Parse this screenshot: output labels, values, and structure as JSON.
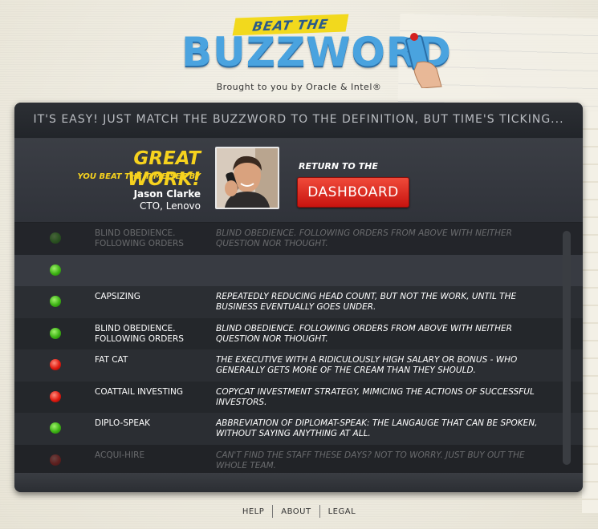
{
  "header": {
    "banner": "BEAT THE",
    "logo": "BUZZWORD",
    "sponsor": "Brought to you by Oracle & Intel®"
  },
  "instruction": "IT'S EASY! JUST MATCH THE BUZZWORD TO THE DEFINITION, BUT TIME'S TICKING...",
  "result": {
    "headline": "GREAT WORK!",
    "beat_text": "YOU BEAT THE TIME SET BY",
    "person_name": "Jason Clarke",
    "person_title": "CTO, Lenovo",
    "return_label": "RETURN TO THE",
    "dashboard_label": "DASHBOARD"
  },
  "rows": [
    {
      "status": "green",
      "faded": true,
      "term": "BLIND OBEDIENCE. FOLLOWING ORDERS",
      "definition": "BLIND OBEDIENCE.  FOLLOWING ORDERS FROM ABOVE WITH NEITHER QUESTION NOR THOUGHT."
    },
    {
      "status": "green",
      "faded": false,
      "empty": true,
      "term": "",
      "definition": ""
    },
    {
      "status": "green",
      "faded": false,
      "term": "CAPSIZING",
      "definition": "REPEATEDLY REDUCING HEAD COUNT, BUT NOT THE WORK, UNTIL THE BUSINESS EVENTUALLY GOES UNDER."
    },
    {
      "status": "green",
      "faded": false,
      "term": "BLIND OBEDIENCE. FOLLOWING ORDERS",
      "definition": "BLIND OBEDIENCE.  FOLLOWING ORDERS FROM ABOVE WITH NEITHER QUESTION NOR THOUGHT."
    },
    {
      "status": "red",
      "faded": false,
      "term": "FAT CAT",
      "definition": "THE EXECUTIVE WITH A RIDICULOUSLY HIGH SALARY OR BONUS - WHO GENERALLY GETS MORE OF THE CREAM THAN THEY SHOULD."
    },
    {
      "status": "red",
      "faded": false,
      "term": "COATTAIL INVESTING",
      "definition": "COPYCAT INVESTMENT STRATEGY, MIMICING THE ACTIONS OF SUCCESSFUL INVESTORS."
    },
    {
      "status": "green",
      "faded": false,
      "term": "DIPLO-SPEAK",
      "definition": "ABBREVIATION OF DIPLOMAT-SPEAK: THE LANGAUGE THAT CAN BE SPOKEN, WITHOUT SAYING ANYTHING AT ALL."
    },
    {
      "status": "red",
      "faded": true,
      "term": "ACQUI-HIRE",
      "definition": "CAN'T FIND THE STAFF THESE DAYS?  NOT TO WORRY. JUST BUY OUT THE WHOLE TEAM."
    }
  ],
  "footer": {
    "help": "HELP",
    "about": "ABOUT",
    "legal": "LEGAL"
  }
}
